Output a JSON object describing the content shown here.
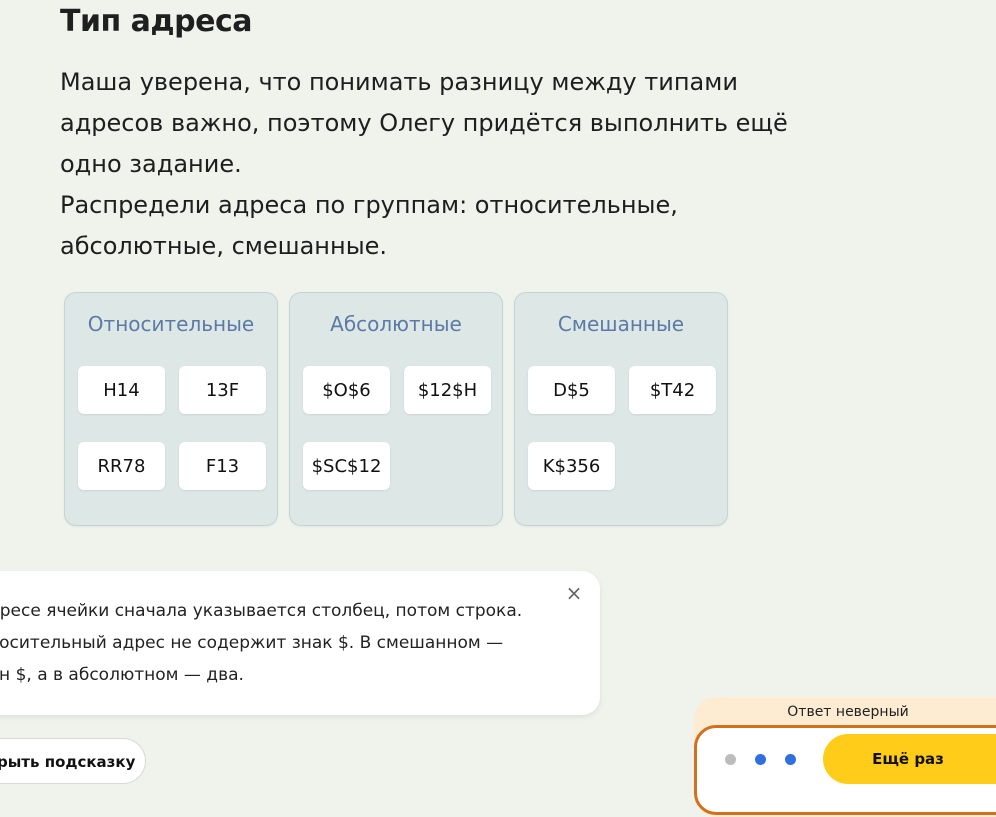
{
  "task": {
    "title": "Тип адреса",
    "paragraph1": "Маша уверена, что понимать разницу между типами адресов важно, поэтому Олегу придётся выполнить ещё одно задание.",
    "paragraph2": "Распредели адреса по группам: относительные, абсолютные, смешанные."
  },
  "groups": [
    {
      "title": "Относительные",
      "items": [
        "H14",
        "13F",
        "RR78",
        "F13"
      ]
    },
    {
      "title": "Абсолютные",
      "items": [
        "$O$6",
        "$12$H",
        "$SC$12"
      ]
    },
    {
      "title": "Смешанные",
      "items": [
        "D$5",
        "$T42",
        "K$356"
      ]
    }
  ],
  "hint": {
    "line1": "дресе ячейки сначала указывается столбец, потом строка.",
    "line2": "носительный адрес не содержит знак $. В смешанном —",
    "line3": "ин $, а в абсолютном — два.",
    "close_label": "×"
  },
  "hide_hint_label": "рыть подсказку",
  "result": {
    "status": "Ответ неверный",
    "retry_label": "Ещё раз",
    "status_color": "#d2701b",
    "dots": [
      "#bcbcbc",
      "#2f6fde",
      "#2f6fde"
    ]
  }
}
